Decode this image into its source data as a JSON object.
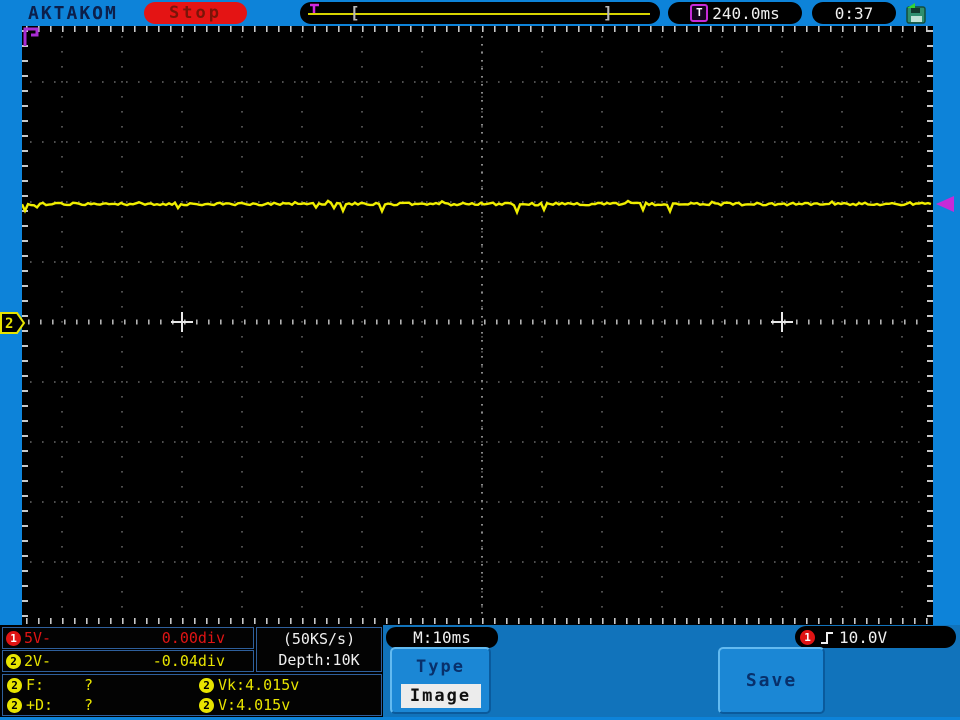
{
  "brand": "AKTAKOM",
  "top_bar": {
    "run_state": "Stop",
    "record_left_bracket": "[",
    "record_right_bracket": "]",
    "trigger_icon": "T",
    "trigger_time": "240.0ms",
    "clock": "0:37",
    "storage_icon": "usb-storage-icon"
  },
  "channels": [
    {
      "num": "1",
      "scale": "5V-",
      "offset": "0.00div",
      "color": "#e01414"
    },
    {
      "num": "2",
      "scale": "2V-",
      "offset": "-0.04div",
      "color": "#e8e400"
    }
  ],
  "acquisition": {
    "sample_rate": "(50KS/s)",
    "depth": "Depth:10K"
  },
  "timebase": {
    "label": "M:10ms"
  },
  "trigger": {
    "channel": "1",
    "slope_icon": "rising-edge-icon",
    "level": "10.0V"
  },
  "measurements": [
    {
      "ch": "2",
      "label": "F:",
      "value": "?"
    },
    {
      "ch": "2",
      "label": "Vk:",
      "value": "4.015v"
    },
    {
      "ch": "2",
      "label": "+D:",
      "value": "?"
    },
    {
      "ch": "2",
      "label": "V:",
      "value": "4.015v"
    }
  ],
  "menu": {
    "type_label": "Type",
    "type_value": "Image",
    "save_label": "Save"
  },
  "left_marker": {
    "label": "2"
  },
  "waveform": {
    "channel": "2",
    "shape": "flat-noisy-line",
    "level_volts": 4.015,
    "divs_above_center": 2.0,
    "trace_color": "#f0ee00"
  },
  "colors": {
    "bezel_blue": "#0d83d9",
    "menu_blue": "#1173bb",
    "button_blue": "#1b87d5",
    "run_state_red": "#e41414",
    "trace_yellow": "#f0ee00",
    "trigger_magenta": "#c62ad8"
  }
}
